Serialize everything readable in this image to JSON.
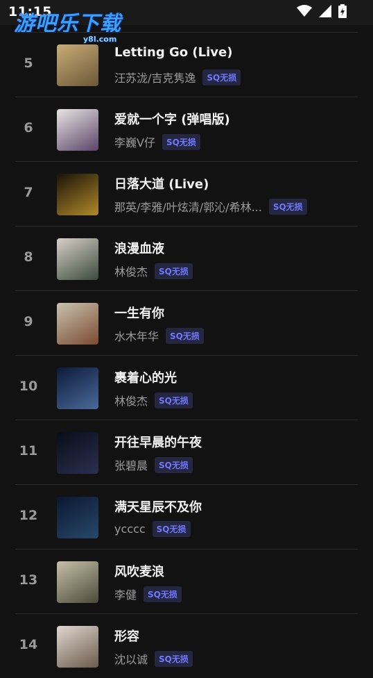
{
  "status_bar": {
    "time": "11:15",
    "icons": [
      "wifi-icon",
      "signal-icon",
      "battery-icon"
    ]
  },
  "watermark": {
    "main": "游吧乐下载",
    "sub": "y8l.com"
  },
  "songs": [
    {
      "rank": "5",
      "title": "Letting Go (Live)",
      "artist": "汪苏泷/吉克隽逸",
      "badge": "SQ无损",
      "cover_colors": [
        "#c9ad78",
        "#6b5636"
      ]
    },
    {
      "rank": "6",
      "title": "爱就一个字 (弹唱版)",
      "artist": "李巍V仔",
      "badge": "SQ无损",
      "cover_colors": [
        "#e8e4e2",
        "#5a4468"
      ]
    },
    {
      "rank": "7",
      "title": "日落大道 (Live)",
      "artist": "那英/李雅/叶炫清/郭沁/希林...",
      "badge": "SQ无损",
      "cover_colors": [
        "#1a1208",
        "#b08a2a"
      ]
    },
    {
      "rank": "8",
      "title": "浪漫血液",
      "artist": "林俊杰",
      "badge": "SQ无损",
      "cover_colors": [
        "#d8d0c8",
        "#3a4a3a"
      ]
    },
    {
      "rank": "9",
      "title": "一生有你",
      "artist": "水木年华",
      "badge": "SQ无损",
      "cover_colors": [
        "#c9c2b0",
        "#7a4a30"
      ]
    },
    {
      "rank": "10",
      "title": "裹着心的光",
      "artist": "林俊杰",
      "badge": "SQ无损",
      "cover_colors": [
        "#0c1a3a",
        "#4a6a9a"
      ]
    },
    {
      "rank": "11",
      "title": "开往早晨的午夜",
      "artist": "张碧晨",
      "badge": "SQ无损",
      "cover_colors": [
        "#0a0c18",
        "#2a3050"
      ]
    },
    {
      "rank": "12",
      "title": "满天星辰不及你",
      "artist": "ycccc",
      "badge": "SQ无损",
      "cover_colors": [
        "#0a1830",
        "#28486a"
      ]
    },
    {
      "rank": "13",
      "title": "风吹麦浪",
      "artist": "李健",
      "badge": "SQ无损",
      "cover_colors": [
        "#c8c0a8",
        "#4a4a3a"
      ]
    },
    {
      "rank": "14",
      "title": "形容",
      "artist": "沈以诚",
      "badge": "SQ无损",
      "cover_colors": [
        "#e0d8d0",
        "#6a5a4a"
      ]
    }
  ]
}
